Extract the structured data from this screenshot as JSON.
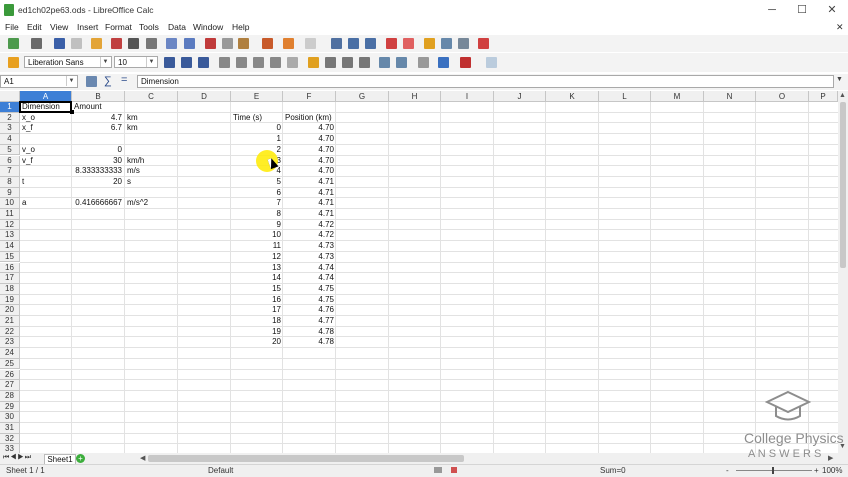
{
  "window": {
    "title": "ed1ch02pe63.ods - LibreOffice Calc",
    "minimize": "─",
    "maximize": "☐",
    "close": "✕",
    "doc_close": "✕"
  },
  "menu": [
    "File",
    "Edit",
    "View",
    "Insert",
    "Format",
    "Tools",
    "Data",
    "Window",
    "Help"
  ],
  "format_toolbar": {
    "font_name": "Liberation Sans",
    "font_size": "10"
  },
  "formula_bar": {
    "name_box": "A1",
    "content": "Dimension",
    "sum_symbol": "∑",
    "equals_symbol": "="
  },
  "columns": [
    "A",
    "B",
    "C",
    "D",
    "E",
    "F",
    "G",
    "H",
    "I",
    "J",
    "K",
    "L",
    "M",
    "N",
    "O",
    "P"
  ],
  "rows": [
    "1",
    "2",
    "3",
    "4",
    "5",
    "6",
    "7",
    "8",
    "9",
    "10",
    "11",
    "12",
    "13",
    "14",
    "15",
    "16",
    "17",
    "18",
    "19",
    "20",
    "21",
    "22",
    "23",
    "24",
    "25",
    "26",
    "27",
    "28",
    "29",
    "30",
    "31",
    "32",
    "33"
  ],
  "cells": {
    "A1": "Dimension",
    "B1": "Amount",
    "A2": "x_o",
    "B2": "4.7",
    "C2": "km",
    "A3": "x_f",
    "B3": "6.7",
    "C3": "km",
    "E2": "Time (s)",
    "F2": "Position (km)",
    "A5": "v_o",
    "B5": "0",
    "A6": "v_f",
    "B6": "30",
    "C6": "km/h",
    "B7": "8.333333333",
    "C7": "m/s",
    "A8": "t",
    "B8": "20",
    "C8": "s",
    "A10": "a",
    "B10": "0.416666667",
    "C10": "m/s^2"
  },
  "time_series": {
    "time": [
      "0",
      "1",
      "2",
      "3",
      "4",
      "5",
      "6",
      "7",
      "8",
      "9",
      "10",
      "11",
      "12",
      "13",
      "14",
      "15",
      "16",
      "17",
      "18",
      "19",
      "20"
    ],
    "position": [
      "4.70",
      "4.70",
      "4.70",
      "4.70",
      "4.70",
      "4.71",
      "4.71",
      "4.71",
      "4.71",
      "4.72",
      "4.72",
      "4.73",
      "4.73",
      "4.74",
      "4.74",
      "4.75",
      "4.75",
      "4.76",
      "4.77",
      "4.78",
      "4.78"
    ]
  },
  "sheet_tabs": {
    "active": "Sheet1"
  },
  "status": {
    "sheet_pos": "Sheet 1 / 1",
    "page_style": "Default",
    "sum": "Sum=0",
    "zoom": "100%",
    "zoom_minus": "-",
    "zoom_plus": "+"
  },
  "watermark": {
    "line1": "College Physics",
    "line2": "A N S W E R S"
  },
  "icons": [
    "app-icon",
    "new-icon",
    "open-icon",
    "save-icon",
    "print-icon",
    "cut-icon",
    "copy-icon",
    "paste-icon",
    "undo-icon",
    "redo-icon",
    "sort-icon",
    "chart-icon",
    "bold-icon",
    "italic-icon",
    "underline-icon",
    "align-left-icon",
    "align-center-icon",
    "align-right-icon",
    "function-wizard-icon",
    "sum-icon"
  ],
  "colors": {
    "selection": "#3d7fd6",
    "highlight": "#ffeb00"
  }
}
